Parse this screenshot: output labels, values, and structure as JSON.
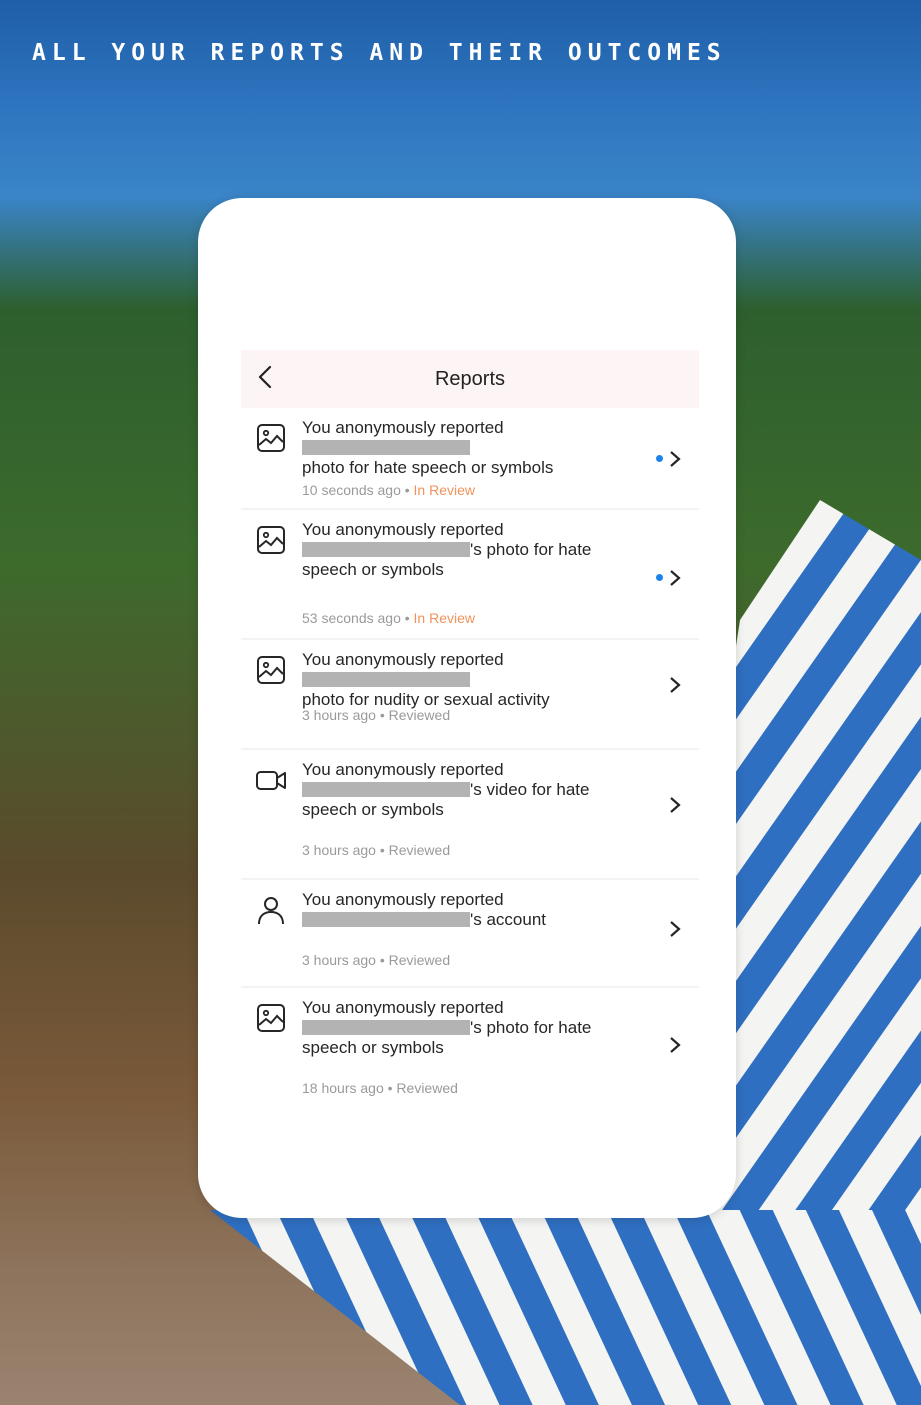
{
  "headline": "ALL YOUR REPORTS AND THEIR OUTCOMES",
  "screen": {
    "title": "Reports",
    "back_icon": "chevron-left-icon"
  },
  "reports": [
    {
      "icon": "photo-icon",
      "line1": "You anonymously reported",
      "line2": "photo for hate speech or symbols",
      "line3": "",
      "time": "10 seconds ago",
      "status": "In Review",
      "unread": true
    },
    {
      "icon": "photo-icon",
      "line1": "You anonymously reported",
      "line2": "'s photo for hate",
      "line3": "speech or symbols",
      "time": "53 seconds ago",
      "status": "In Review",
      "unread": true
    },
    {
      "icon": "photo-icon",
      "line1": "You anonymously reported",
      "line2": "photo for nudity or sexual activity",
      "line3": "",
      "time": "3 hours ago",
      "status": "Reviewed",
      "unread": false
    },
    {
      "icon": "video-icon",
      "line1": "You anonymously reported",
      "line2": "'s video for hate",
      "line3": "speech or symbols",
      "time": "3 hours ago",
      "status": "Reviewed",
      "unread": false
    },
    {
      "icon": "person-icon",
      "line1": "You anonymously reported",
      "line2": "'s account",
      "line3": "",
      "time": "3 hours ago",
      "status": "Reviewed",
      "unread": false
    },
    {
      "icon": "photo-icon",
      "line1": "You anonymously reported",
      "line2": "'s photo for hate",
      "line3": "speech or symbols",
      "time": "18 hours ago",
      "status": "Reviewed",
      "unread": false
    }
  ],
  "separator": "•",
  "colors": {
    "status_in_review": "#f0935d",
    "status_reviewed": "#9a9a9a",
    "unread_dot": "#1d83ea"
  }
}
